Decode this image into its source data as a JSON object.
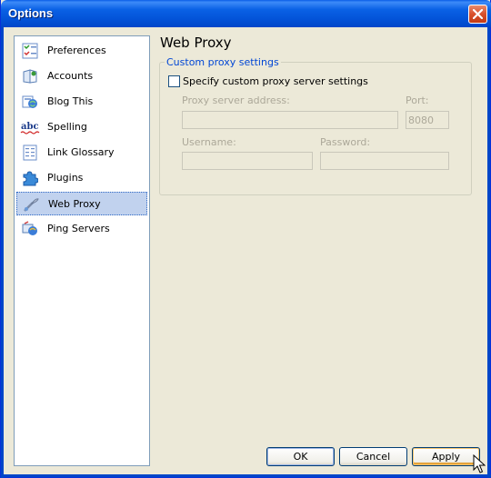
{
  "window": {
    "title": "Options"
  },
  "sidebar": {
    "items": [
      {
        "label": "Preferences",
        "icon": "preferences-icon"
      },
      {
        "label": "Accounts",
        "icon": "accounts-icon"
      },
      {
        "label": "Blog This",
        "icon": "blog-this-icon"
      },
      {
        "label": "Spelling",
        "icon": "spelling-abc-icon"
      },
      {
        "label": "Link Glossary",
        "icon": "link-glossary-icon"
      },
      {
        "label": "Plugins",
        "icon": "puzzle-piece-icon"
      },
      {
        "label": "Web Proxy",
        "icon": "web-proxy-icon",
        "selected": true
      },
      {
        "label": "Ping Servers",
        "icon": "ping-servers-icon"
      }
    ]
  },
  "panel": {
    "title": "Web Proxy",
    "group_label": "Custom proxy settings",
    "checkbox_label": "Specify custom proxy server settings",
    "checkbox_checked": false,
    "address_label": "Proxy server address:",
    "address_value": "",
    "port_label": "Port:",
    "port_value": "8080",
    "username_label": "Username:",
    "username_value": "",
    "password_label": "Password:",
    "password_value": ""
  },
  "buttons": {
    "ok": "OK",
    "cancel": "Cancel",
    "apply": "Apply"
  },
  "colors": {
    "titlebar": "#0a5ee8",
    "group_label": "#0046d5",
    "selected_item": "#c1d2ee",
    "disabled_text": "#aca899"
  }
}
